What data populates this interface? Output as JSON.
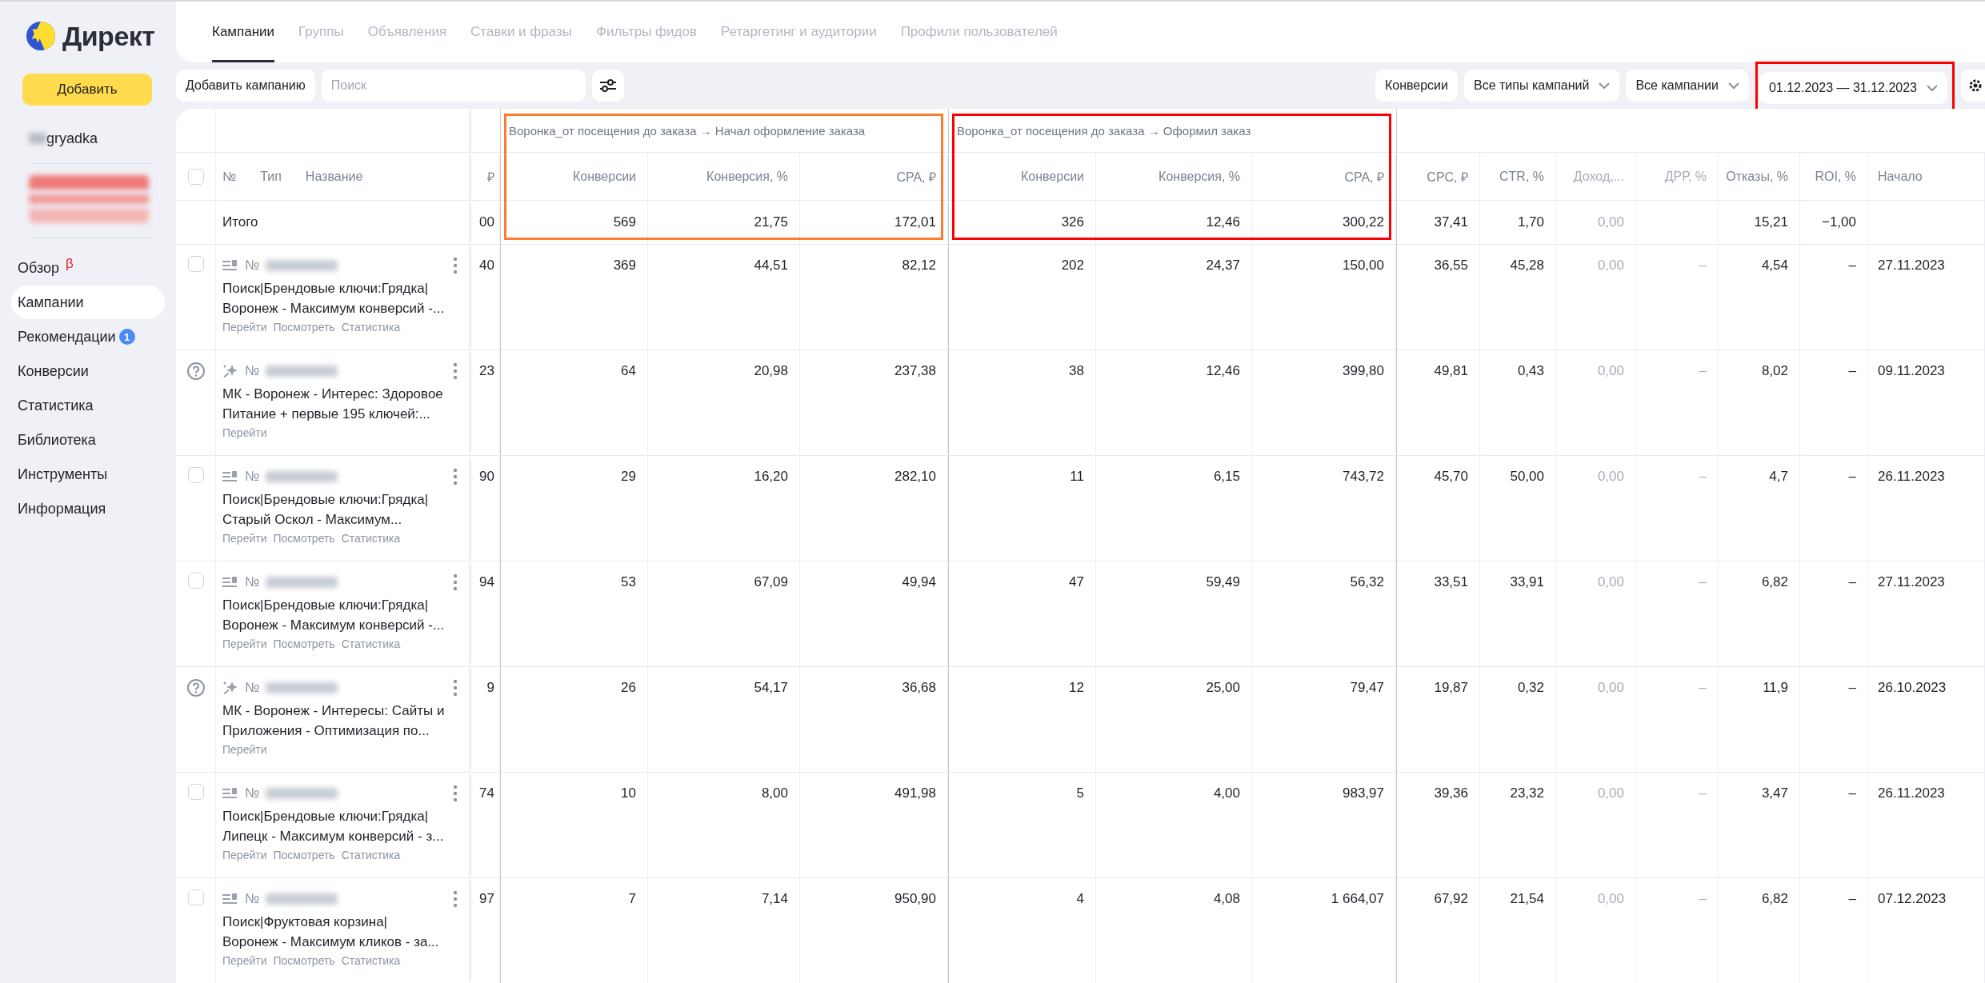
{
  "sidebar": {
    "logo": "Директ",
    "add_button": "Добавить",
    "account": "gryadka",
    "nav": [
      {
        "label": "Обзор",
        "selected": false,
        "beta": "β"
      },
      {
        "label": "Кампании",
        "selected": true
      },
      {
        "label": "Рекомендации",
        "selected": false,
        "badge": "1"
      },
      {
        "label": "Конверсии",
        "selected": false
      },
      {
        "label": "Статистика",
        "selected": false
      },
      {
        "label": "Библиотека",
        "selected": false
      },
      {
        "label": "Инструменты",
        "selected": false
      },
      {
        "label": "Информация",
        "selected": false
      }
    ]
  },
  "tabs": [
    {
      "label": "Кампании",
      "selected": true
    },
    {
      "label": "Группы",
      "selected": false
    },
    {
      "label": "Объявления",
      "selected": false
    },
    {
      "label": "Ставки и фразы",
      "selected": false
    },
    {
      "label": "Фильтры фидов",
      "selected": false
    },
    {
      "label": "Ретаргетинг и аудитории",
      "selected": false
    },
    {
      "label": "Профили пользователей",
      "selected": false
    }
  ],
  "toolbar": {
    "add_campaign": "Добавить кампанию",
    "search": {
      "placeholder": "Поиск"
    },
    "filters": [
      {
        "label": "Конверсии",
        "dropdown": false
      },
      {
        "label": "Все типы кампаний",
        "dropdown": true
      },
      {
        "label": "Все кампании",
        "dropdown": true
      }
    ],
    "date_range": {
      "label": "01.12.2023 — 31.12.2023",
      "color": "#ff0000"
    }
  },
  "table": {
    "header": {
      "checked": false,
      "number": "№",
      "type": "Тип",
      "name": "Название",
      "column_3": "₽"
    },
    "groups": [
      {
        "title": "Воронка_от посещения до заказа → Начал оформление заказа",
        "color": "#ff7a2f",
        "columns": [
          {
            "label": "Конверсии",
            "total": "569"
          },
          {
            "label": "Конверсия, %",
            "total": "21,75"
          },
          {
            "label": "CPA, ₽",
            "total": "172,01"
          }
        ]
      },
      {
        "title": "Воронка_от посещения до заказа → Оформил заказ",
        "color": "#ff0000",
        "columns": [
          {
            "label": "Конверсии",
            "total": "326"
          },
          {
            "label": "Конверсия, %",
            "total": "12,46"
          },
          {
            "label": "CPA, ₽",
            "total": "300,22"
          }
        ]
      }
    ],
    "columns": [
      {
        "label": "CPC, ₽",
        "kind": "number",
        "muted": false,
        "total": "37,41"
      },
      {
        "label": "CTR, %",
        "kind": "number",
        "muted": false,
        "total": "1,70"
      },
      {
        "label": "Доход,...",
        "kind": "number",
        "muted": true,
        "total": "0,00"
      },
      {
        "label": "ДРР, %",
        "kind": "number",
        "muted": true
      },
      {
        "label": "Отказы, %",
        "kind": "number",
        "muted": false,
        "total": "15,21"
      },
      {
        "label": "ROI, %",
        "kind": "number",
        "muted": false,
        "total": "−1,00"
      },
      {
        "label": "Начало",
        "kind": "date",
        "muted": false
      }
    ],
    "total": {
      "label": "Итого",
      "column_3": "00"
    },
    "rows": [
      {
        "kind": "search",
        "checked": false,
        "number": "№",
        "name_lines": [
          "Поиск|Брендовые ключи:Грядка|",
          "Воронеж - Максимум конверсий -..."
        ],
        "links": [
          "Перейти",
          "Посмотреть",
          "Статистика"
        ],
        "column_3": "40",
        "values": [
          "369",
          "44,51",
          "82,12",
          "202",
          "24,37",
          "150,00",
          "36,55",
          "45,28",
          "0,00",
          "–",
          "4,54",
          "–",
          "27.11.2023"
        ]
      },
      {
        "kind": "mk",
        "number": "№",
        "name_lines": [
          "МК - Воронеж - Интерес: Здоровое",
          "Питание + первые 195 ключей:..."
        ],
        "links": [
          "Перейти"
        ],
        "column_3": "23",
        "values": [
          "64",
          "20,98",
          "237,38",
          "38",
          "12,46",
          "399,80",
          "49,81",
          "0,43",
          "0,00",
          "–",
          "8,02",
          "–",
          "09.11.2023"
        ]
      },
      {
        "kind": "search",
        "checked": false,
        "number": "№",
        "name_lines": [
          "Поиск|Брендовые ключи:Грядка|",
          "Старый Оскол - Максимум..."
        ],
        "links": [
          "Перейти",
          "Посмотреть",
          "Статистика"
        ],
        "column_3": "90",
        "values": [
          "29",
          "16,20",
          "282,10",
          "11",
          "6,15",
          "743,72",
          "45,70",
          "50,00",
          "0,00",
          "–",
          "4,7",
          "–",
          "26.11.2023"
        ]
      },
      {
        "kind": "search",
        "checked": false,
        "number": "№",
        "name_lines": [
          "Поиск|Брендовые ключи:Грядка|",
          "Воронеж - Максимум конверсий -..."
        ],
        "links": [
          "Перейти",
          "Посмотреть",
          "Статистика"
        ],
        "column_3": "94",
        "values": [
          "53",
          "67,09",
          "49,94",
          "47",
          "59,49",
          "56,32",
          "33,51",
          "33,91",
          "0,00",
          "–",
          "6,82",
          "–",
          "27.11.2023"
        ]
      },
      {
        "kind": "mk",
        "number": "№",
        "name_lines": [
          "МК - Воронеж - Интересы: Сайты и",
          "Приложения - Оптимизация по..."
        ],
        "links": [
          "Перейти"
        ],
        "column_3": "9",
        "values": [
          "26",
          "54,17",
          "36,68",
          "12",
          "25,00",
          "79,47",
          "19,87",
          "0,32",
          "0,00",
          "–",
          "11,9",
          "–",
          "26.10.2023"
        ]
      },
      {
        "kind": "search",
        "checked": false,
        "number": "№",
        "name_lines": [
          "Поиск|Брендовые ключи:Грядка|",
          "Липецк - Максимум конверсий - з..."
        ],
        "links": [
          "Перейти",
          "Посмотреть",
          "Статистика"
        ],
        "column_3": "74",
        "values": [
          "10",
          "8,00",
          "491,98",
          "5",
          "4,00",
          "983,97",
          "39,36",
          "23,32",
          "0,00",
          "–",
          "3,47",
          "–",
          "26.11.2023"
        ]
      },
      {
        "kind": "search",
        "checked": false,
        "number": "№",
        "name_lines": [
          "Поиск|Фруктовая корзина|",
          "Воронеж - Максимум кликов - за..."
        ],
        "links": [
          "Перейти",
          "Посмотреть",
          "Статистика"
        ],
        "column_3": "97",
        "values": [
          "7",
          "7,14",
          "950,90",
          "4",
          "4,08",
          "1 664,07",
          "67,92",
          "21,54",
          "0,00",
          "–",
          "6,82",
          "–",
          "07.12.2023"
        ]
      }
    ]
  }
}
